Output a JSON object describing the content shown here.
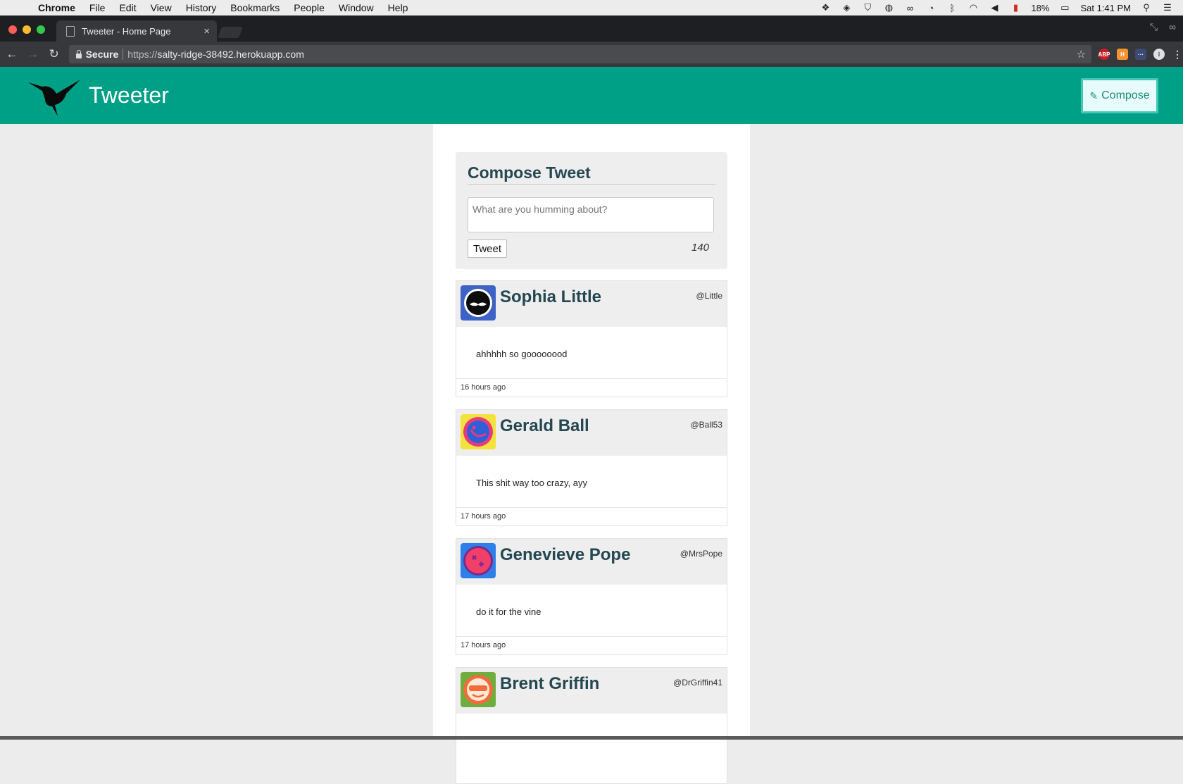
{
  "menubar": {
    "app_name": "Chrome",
    "items": [
      "File",
      "Edit",
      "View",
      "History",
      "Bookmarks",
      "People",
      "Window",
      "Help"
    ],
    "battery": "18%",
    "clock": "Sat 1:41 PM"
  },
  "browser": {
    "tab_title": "Tweeter - Home Page",
    "tab_close": "×",
    "secure_label": "Secure",
    "url_scheme": "https://",
    "url_host": "salty-ridge-38492.herokuapp.com"
  },
  "app": {
    "brand": "Tweeter",
    "compose_button": "Compose",
    "accent_color": "#00a087"
  },
  "compose": {
    "title": "Compose Tweet",
    "placeholder": "What are you humming about?",
    "submit_label": "Tweet",
    "char_count": "140"
  },
  "tweets": [
    {
      "name": "Sophia Little",
      "handle": "@Little",
      "text": "ahhhhh so goooooood",
      "time": "16 hours ago",
      "avatar_color": "#3d63c7"
    },
    {
      "name": "Gerald Ball",
      "handle": "@Ball53",
      "text": "This shit way too crazy, ayy",
      "time": "17 hours ago",
      "avatar_color": "#f4e23c"
    },
    {
      "name": "Genevieve Pope",
      "handle": "@MrsPope",
      "text": "do it for the vine",
      "time": "17 hours ago",
      "avatar_color": "#2f7fe8"
    },
    {
      "name": "Brent Griffin",
      "handle": "@DrGriffin41",
      "text": "",
      "time": "",
      "avatar_color": "#6fae3e"
    }
  ]
}
